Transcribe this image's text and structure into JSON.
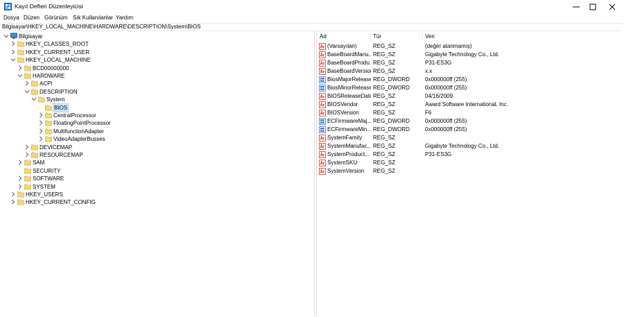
{
  "window": {
    "title": "Kayıt Defteri Düzenleyicisi"
  },
  "menu": [
    "Dosya",
    "Düzen",
    "Görünüm",
    "Sık Kullanılanlar",
    "Yardım"
  ],
  "address": "Bilgisayar\\HKEY_LOCAL_MACHINE\\HARDWARE\\DESCRIPTION\\System\\BIOS",
  "tree": [
    {
      "label": "Bilgisayar",
      "depth": 0,
      "exp": "open",
      "icon": "computer"
    },
    {
      "label": "HKEY_CLASSES_ROOT",
      "depth": 1,
      "exp": "closed",
      "icon": "folder"
    },
    {
      "label": "HKEY_CURRENT_USER",
      "depth": 1,
      "exp": "closed",
      "icon": "folder"
    },
    {
      "label": "HKEY_LOCAL_MACHINE",
      "depth": 1,
      "exp": "open",
      "icon": "folder"
    },
    {
      "label": "BCD00000000",
      "depth": 2,
      "exp": "closed",
      "icon": "folder"
    },
    {
      "label": "HARDWARE",
      "depth": 2,
      "exp": "open",
      "icon": "folder"
    },
    {
      "label": "ACPI",
      "depth": 3,
      "exp": "closed",
      "icon": "folder"
    },
    {
      "label": "DESCRIPTION",
      "depth": 3,
      "exp": "open",
      "icon": "folder"
    },
    {
      "label": "System",
      "depth": 4,
      "exp": "open",
      "icon": "folder"
    },
    {
      "label": "BIOS",
      "depth": 5,
      "exp": "none",
      "icon": "folder",
      "selected": true
    },
    {
      "label": "CentralProcessor",
      "depth": 5,
      "exp": "closed",
      "icon": "folder"
    },
    {
      "label": "FloatingPointProcessor",
      "depth": 5,
      "exp": "closed",
      "icon": "folder"
    },
    {
      "label": "MultifunctionAdapter",
      "depth": 5,
      "exp": "closed",
      "icon": "folder"
    },
    {
      "label": "VideoAdapterBusses",
      "depth": 5,
      "exp": "closed",
      "icon": "folder"
    },
    {
      "label": "DEVICEMAP",
      "depth": 3,
      "exp": "closed",
      "icon": "folder"
    },
    {
      "label": "RESOURCEMAP",
      "depth": 3,
      "exp": "closed",
      "icon": "folder"
    },
    {
      "label": "SAM",
      "depth": 2,
      "exp": "closed",
      "icon": "folder"
    },
    {
      "label": "SECURITY",
      "depth": 2,
      "exp": "none",
      "icon": "folder"
    },
    {
      "label": "SOFTWARE",
      "depth": 2,
      "exp": "closed",
      "icon": "folder"
    },
    {
      "label": "SYSTEM",
      "depth": 2,
      "exp": "closed",
      "icon": "folder"
    },
    {
      "label": "HKEY_USERS",
      "depth": 1,
      "exp": "closed",
      "icon": "folder"
    },
    {
      "label": "HKEY_CURRENT_CONFIG",
      "depth": 1,
      "exp": "closed",
      "icon": "folder"
    }
  ],
  "columns": {
    "name": "Ad",
    "type": "Tür",
    "data": "Veri"
  },
  "values": [
    {
      "name": "(Varsayılan)",
      "type": "REG_SZ",
      "data": "(değer atanmamış)",
      "icon": "string-icon"
    },
    {
      "name": "BaseBoardManu...",
      "type": "REG_SZ",
      "data": "Gigabyte Technology Co., Ltd.",
      "icon": "string-icon"
    },
    {
      "name": "BaseBoardProdu...",
      "type": "REG_SZ",
      "data": "P31-ES3G",
      "icon": "string-icon"
    },
    {
      "name": "BaseBoardVersion",
      "type": "REG_SZ",
      "data": "x.x",
      "icon": "string-icon"
    },
    {
      "name": "BiosMajorRelease",
      "type": "REG_DWORD",
      "data": "0x000000ff (255)",
      "icon": "binary-icon"
    },
    {
      "name": "BiosMinorRelease",
      "type": "REG_DWORD",
      "data": "0x000000ff (255)",
      "icon": "binary-icon"
    },
    {
      "name": "BIOSReleaseDate",
      "type": "REG_SZ",
      "data": "04/16/2009",
      "icon": "string-icon"
    },
    {
      "name": "BIOSVendor",
      "type": "REG_SZ",
      "data": "Award Software International, Inc.",
      "icon": "string-icon"
    },
    {
      "name": "BIOSVersion",
      "type": "REG_SZ",
      "data": "F6",
      "icon": "string-icon"
    },
    {
      "name": "ECFirmwareMaj...",
      "type": "REG_DWORD",
      "data": "0x000000ff (255)",
      "icon": "binary-icon"
    },
    {
      "name": "ECFirmwareMin...",
      "type": "REG_DWORD",
      "data": "0x000000ff (255)",
      "icon": "binary-icon"
    },
    {
      "name": "SystemFamily",
      "type": "REG_SZ",
      "data": "",
      "icon": "string-icon"
    },
    {
      "name": "SystemManufac...",
      "type": "REG_SZ",
      "data": "Gigabyte Technology Co., Ltd.",
      "icon": "string-icon"
    },
    {
      "name": "SystemProduct...",
      "type": "REG_SZ",
      "data": "P31-ES3G",
      "icon": "string-icon"
    },
    {
      "name": "SystemSKU",
      "type": "REG_SZ",
      "data": "",
      "icon": "string-icon"
    },
    {
      "name": "SystemVersion",
      "type": "REG_SZ",
      "data": "",
      "icon": "string-icon"
    }
  ],
  "colors": {
    "folder": "#f7d77a",
    "folder_edge": "#d9a93a",
    "selection": "#cce8ff",
    "string_icon": "#c0392b",
    "binary_icon": "#2c6fb5"
  }
}
